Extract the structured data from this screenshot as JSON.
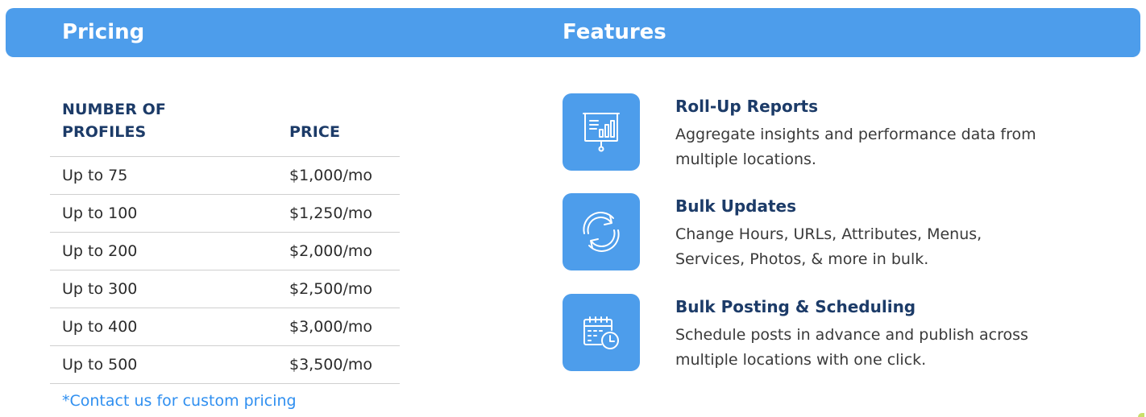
{
  "header": {
    "pricing_title": "Pricing",
    "features_title": "Features"
  },
  "pricing_table": {
    "columns": [
      "NUMBER OF PROFILES",
      "PRICE"
    ],
    "rows": [
      {
        "profiles": "Up to 75",
        "price": "$1,000/mo"
      },
      {
        "profiles": "Up to 100",
        "price": "$1,250/mo"
      },
      {
        "profiles": "Up to 200",
        "price": "$2,000/mo"
      },
      {
        "profiles": "Up to 300",
        "price": "$2,500/mo"
      },
      {
        "profiles": "Up to 400",
        "price": "$3,000/mo"
      },
      {
        "profiles": "Up to 500",
        "price": "$3,500/mo"
      }
    ],
    "note": "*Contact us for custom pricing"
  },
  "features": [
    {
      "icon": "presentation-chart-icon",
      "title": "Roll-Up Reports",
      "description": "Aggregate insights and performance data from multiple locations."
    },
    {
      "icon": "refresh-icon",
      "title": "Bulk Updates",
      "description": "Change Hours, URLs, Attributes, Menus, Services, Photos, & more in bulk."
    },
    {
      "icon": "calendar-clock-icon",
      "title": "Bulk Posting & Scheduling",
      "description": "Schedule posts in advance and publish across multiple locations with one click."
    }
  ],
  "colors": {
    "accent_blue": "#4d9deb",
    "heading_navy": "#1c3b68",
    "link_blue": "#2f8ff0",
    "divider": "#cfcfcf"
  }
}
